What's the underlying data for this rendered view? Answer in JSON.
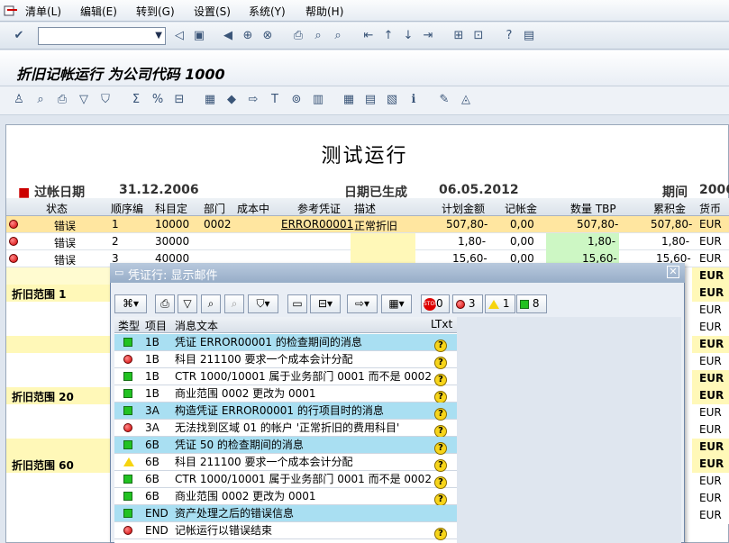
{
  "menu": [
    "清单(L)",
    "编辑(E)",
    "转到(G)",
    "设置(S)",
    "系统(Y)",
    "帮助(H)"
  ],
  "title": "折旧记帐运行 为公司代码 1000",
  "report": {
    "title": "测试运行",
    "cut_left": "过帐日期",
    "cut_date": "31.12.2006",
    "cut_mid": "日期已生成",
    "cut_mid_date": "06.05.2012",
    "cut_right": "期间",
    "cut_right_val": "2006"
  },
  "grid": {
    "headers": [
      "状态",
      "顺序编",
      "科目定",
      "部门",
      "成本中",
      "参考凭证",
      "描述",
      "计划金额",
      "记帐金",
      "数量 TBP",
      "累积金",
      "货币"
    ],
    "rows": [
      {
        "status": "错误",
        "seq": "1",
        "acct": "10000",
        "dept": "0002",
        "ref": "ERROR00001",
        "desc": "正常折旧",
        "plan": "507,80-",
        "post": "0,00",
        "qty": "507,80-",
        "accum": "507,80-",
        "cur": "EUR"
      },
      {
        "status": "错误",
        "seq": "2",
        "acct": "30000",
        "dept": "",
        "ref": "",
        "desc": "",
        "plan": "1,80-",
        "post": "0,00",
        "qty": "1,80-",
        "accum": "1,80-",
        "cur": "EUR"
      },
      {
        "status": "错误",
        "seq": "3",
        "acct": "40000",
        "dept": "",
        "ref": "",
        "desc": "",
        "plan": "15,60-",
        "post": "0,00",
        "qty": "15,60-",
        "accum": "15,60-",
        "cur": "EUR"
      }
    ],
    "side_labels": [
      "折旧范围  1",
      "折旧范围 20",
      "折旧范围 60"
    ],
    "eur": "EUR"
  },
  "dialog": {
    "title": "凭证行: 显示邮件",
    "counts": {
      "stop": "0",
      "error": "3",
      "warning": "1",
      "ok": "8"
    },
    "headers": [
      "类型",
      "项目",
      "消息文本",
      "LTxt"
    ],
    "rows": [
      {
        "type": "ok",
        "item": "1B",
        "text": "凭证 ERROR00001 的检查期间的消息",
        "help": true,
        "hl": true
      },
      {
        "type": "err",
        "item": "1B",
        "text": "科目 211100 要求一个成本会计分配",
        "help": true,
        "hl": false
      },
      {
        "type": "ok",
        "item": "1B",
        "text": "CTR 1000/10001 属于业务部门 0001 而不是 0002",
        "help": true,
        "hl": false
      },
      {
        "type": "ok",
        "item": "1B",
        "text": "商业范围 0002 更改为 0001",
        "help": true,
        "hl": false
      },
      {
        "type": "ok",
        "item": "3A",
        "text": "构造凭证 ERROR00001 的行项目时的消息",
        "help": true,
        "hl": true
      },
      {
        "type": "err",
        "item": "3A",
        "text": "无法找到区域 01 的帐户 '正常折旧的费用科目'",
        "help": true,
        "hl": false
      },
      {
        "type": "ok",
        "item": "6B",
        "text": "凭证 50 的检查期间的消息",
        "help": true,
        "hl": true
      },
      {
        "type": "warn",
        "item": "6B",
        "text": "科目 211100 要求一个成本会计分配",
        "help": true,
        "hl": false
      },
      {
        "type": "ok",
        "item": "6B",
        "text": "CTR 1000/10001 属于业务部门 0001 而不是 0002",
        "help": true,
        "hl": false
      },
      {
        "type": "ok",
        "item": "6B",
        "text": "商业范围 0002 更改为 0001",
        "help": true,
        "hl": false
      },
      {
        "type": "ok",
        "item": "END",
        "text": "资产处理之后的错误信息",
        "help": false,
        "hl": true
      },
      {
        "type": "err",
        "item": "END",
        "text": "记帐运行以错误结束",
        "help": true,
        "hl": false
      }
    ]
  }
}
